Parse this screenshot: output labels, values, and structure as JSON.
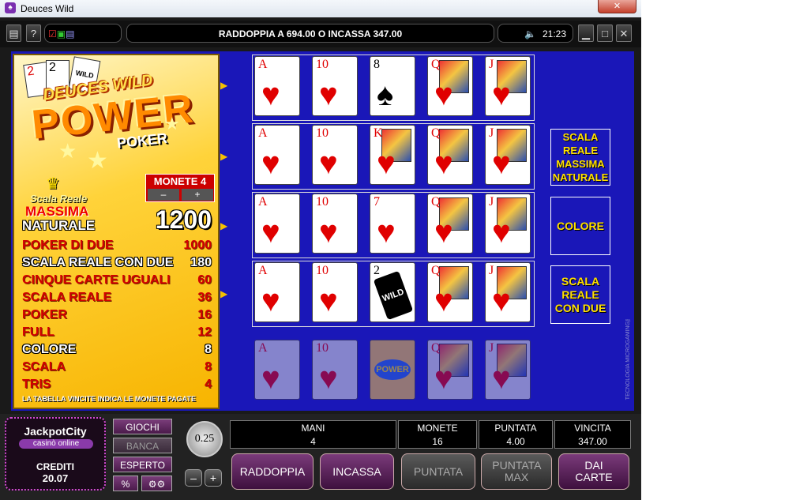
{
  "window": {
    "title": "Deuces Wild",
    "close_label": "✕"
  },
  "toolbar": {
    "message": "RADDOPPIA A 694.00 O INCASSA 347.00",
    "clock": "21:23"
  },
  "logo": {
    "line1": "DEUCES WILD",
    "line2": "POWER",
    "line3": "POKER",
    "cards": [
      "2",
      "2",
      "WILD"
    ]
  },
  "coins": {
    "label": "MONETE 4",
    "minus": "–",
    "plus": "+"
  },
  "top_prize": {
    "line1": "Scala Reale",
    "line2": "MASSIMA",
    "line3": "NATURALE",
    "value": "1200"
  },
  "paytable": [
    {
      "name": "POKER DI DUE",
      "value": "1000"
    },
    {
      "name": "SCALA REALE CON DUE",
      "value": "180"
    },
    {
      "name": "CINQUE CARTE UGUALI",
      "value": "60"
    },
    {
      "name": "SCALA REALE",
      "value": "36"
    },
    {
      "name": "POKER",
      "value": "16"
    },
    {
      "name": "FULL",
      "value": "12"
    },
    {
      "name": "COLORE",
      "value": "8"
    },
    {
      "name": "SCALA",
      "value": "8"
    },
    {
      "name": "TRIS",
      "value": "4"
    }
  ],
  "paytable_note": "LA TABELLA VINCITE INDICA LE MONETE PAGATE",
  "hands": [
    {
      "cards": [
        {
          "rank": "A",
          "suit": "♥"
        },
        {
          "rank": "10",
          "suit": "♥"
        },
        {
          "rank": "8",
          "suit": "♠"
        },
        {
          "rank": "Q",
          "suit": "♥"
        },
        {
          "rank": "J",
          "suit": "♥"
        }
      ],
      "result": ""
    },
    {
      "cards": [
        {
          "rank": "A",
          "suit": "♥"
        },
        {
          "rank": "10",
          "suit": "♥"
        },
        {
          "rank": "K",
          "suit": "♥"
        },
        {
          "rank": "Q",
          "suit": "♥"
        },
        {
          "rank": "J",
          "suit": "♥"
        }
      ],
      "result": "SCALA REALE MASSIMA NATURALE"
    },
    {
      "cards": [
        {
          "rank": "A",
          "suit": "♥"
        },
        {
          "rank": "10",
          "suit": "♥"
        },
        {
          "rank": "7",
          "suit": "♥"
        },
        {
          "rank": "Q",
          "suit": "♥"
        },
        {
          "rank": "J",
          "suit": "♥"
        }
      ],
      "result": "COLORE"
    },
    {
      "cards": [
        {
          "rank": "A",
          "suit": "♥"
        },
        {
          "rank": "10",
          "suit": "♥"
        },
        {
          "rank": "2",
          "suit": "WILD"
        },
        {
          "rank": "Q",
          "suit": "♥"
        },
        {
          "rank": "J",
          "suit": "♥"
        }
      ],
      "result": "SCALA REALE CON DUE"
    },
    {
      "cards": [
        {
          "rank": "A",
          "suit": "♥"
        },
        {
          "rank": "10",
          "suit": "♥"
        },
        {
          "rank": "",
          "suit": "POWER"
        },
        {
          "rank": "Q",
          "suit": "♥"
        },
        {
          "rank": "J",
          "suit": "♥"
        }
      ],
      "result": ""
    }
  ],
  "side_text": "TECNOLOGIA MICROGAMING™",
  "brand": {
    "name": "JackpotCity",
    "sub": "casinò online"
  },
  "credits": {
    "label": "CREDITI",
    "value": "20.07"
  },
  "menu": {
    "games": "GIOCHI",
    "bank": "BANCA",
    "expert": "ESPERTO",
    "percent": "%",
    "gears": "⚙⚙"
  },
  "coin_value": "0.25",
  "coin_minus": "–",
  "coin_plus": "+",
  "stats": {
    "hands": {
      "label": "MANI",
      "value": "4"
    },
    "coins": {
      "label": "MONETE",
      "value": "16"
    },
    "bet": {
      "label": "PUNTATA",
      "value": "4.00"
    },
    "win": {
      "label": "VINCITA",
      "value": "347.00"
    }
  },
  "buttons": {
    "double": "RADDOPPIA",
    "collect": "INCASSA",
    "bet": "PUNTATA",
    "bet_max": "PUNTATA MAX",
    "deal": "DAI CARTE"
  }
}
